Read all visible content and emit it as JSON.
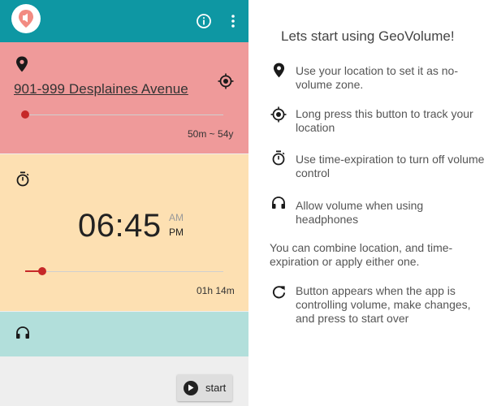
{
  "app": {
    "menu_icons": [
      "info-icon",
      "more-vert-icon"
    ],
    "logo_icon": "volume-pin-icon"
  },
  "location": {
    "address": "901-999 Desplaines Avenue",
    "range_value": "50m ~ 54y",
    "slider_fraction": 0.0
  },
  "time": {
    "clock": "06:45",
    "am": "AM",
    "pm": "PM",
    "duration_value": "01h 14m",
    "slider_fraction": 0.09
  },
  "actions": {
    "start_label": "start"
  },
  "help": {
    "title": "Lets start using GeoVolume!",
    "items": [
      {
        "icon": "location-pin-icon",
        "text": "Use your location to set it as no-volume zone."
      },
      {
        "icon": "gps-target-icon",
        "text": "Long press this button to track your location"
      },
      {
        "icon": "stopwatch-icon",
        "text": "Use time-expiration to turn off volume control"
      },
      {
        "icon": "headphones-icon",
        "text": "Allow volume when using headphones"
      }
    ],
    "combine_text": "You can combine location, and time-expiration or apply either one.",
    "refresh": {
      "icon": "refresh-icon",
      "text": "Button appears when the app is controlling volume, make changes, and press to start over"
    }
  },
  "colors": {
    "toolbar": "#0e97a3",
    "location_card": "#ef9a9a",
    "time_card": "#fde0b2",
    "headphone_card": "#b2dfdb",
    "slider_accent": "#c62828"
  }
}
